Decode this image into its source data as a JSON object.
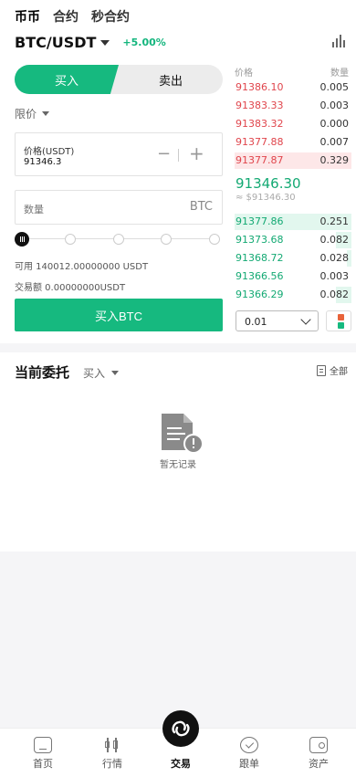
{
  "top_tabs": [
    "币币",
    "合约",
    "秒合约"
  ],
  "pair": {
    "name": "BTC/USDT",
    "change": "+5.00%"
  },
  "side": {
    "buy_label": "买入",
    "sell_label": "卖出"
  },
  "order_type": "限价",
  "price_field": {
    "label": "价格(USDT)",
    "value": "91346.3",
    "minus": "−",
    "plus": "+"
  },
  "qty_field": {
    "placeholder": "数量",
    "unit": "BTC"
  },
  "slider": {
    "value_percent": 0,
    "steps": [
      0,
      25,
      50,
      75,
      100
    ]
  },
  "available": "可用 140012.00000000 USDT",
  "trade_amount": "交易额 0.00000000USDT",
  "buy_button": "买入BTC",
  "orderbook": {
    "headers": {
      "price": "价格",
      "qty": "数量"
    },
    "asks": [
      {
        "price": "91386.10",
        "qty": "0.005"
      },
      {
        "price": "91383.33",
        "qty": "0.003"
      },
      {
        "price": "91383.32",
        "qty": "0.000"
      },
      {
        "price": "91377.88",
        "qty": "0.007"
      },
      {
        "price": "91377.87",
        "qty": "0.329"
      }
    ],
    "last_price": "91346.30",
    "last_fiat": "≈ $91346.30",
    "bids": [
      {
        "price": "91377.86",
        "qty": "0.251"
      },
      {
        "price": "91373.68",
        "qty": "0.082"
      },
      {
        "price": "91368.72",
        "qty": "0.028"
      },
      {
        "price": "91366.56",
        "qty": "0.003"
      },
      {
        "price": "91366.29",
        "qty": "0.082"
      }
    ],
    "depth_value": "0.01"
  },
  "current_orders": {
    "title": "当前委托",
    "filter": "买入",
    "all_label": "全部",
    "empty_text": "暂无记录"
  },
  "bottom_nav": [
    {
      "label": "首页",
      "icon": "home-icon"
    },
    {
      "label": "行情",
      "icon": "market-icon"
    },
    {
      "label": "交易",
      "icon": "trade-icon"
    },
    {
      "label": "跟单",
      "icon": "follow-icon"
    },
    {
      "label": "资产",
      "icon": "wallet-icon"
    }
  ],
  "colors": {
    "accent": "#16b97f",
    "ask": "#e0454c",
    "bid": "#13a973"
  }
}
